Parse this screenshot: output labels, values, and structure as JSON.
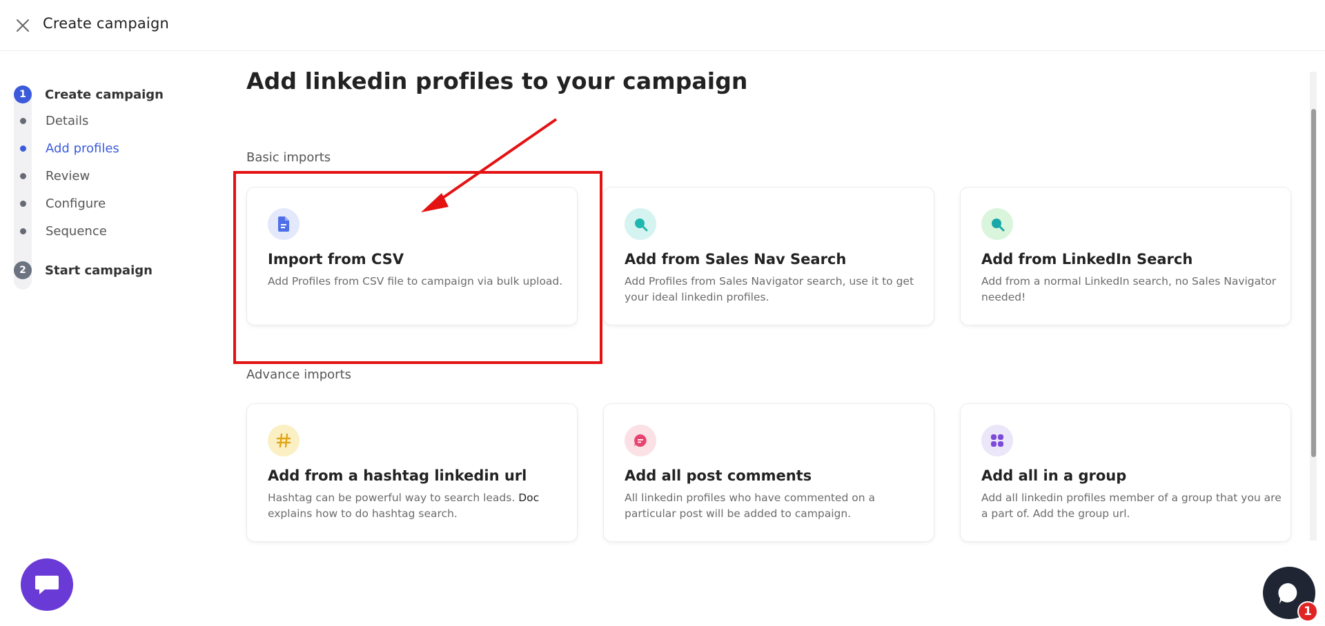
{
  "header": {
    "title": "Create campaign"
  },
  "stepper": {
    "steps": [
      {
        "number": "1",
        "label": "Create campaign"
      },
      {
        "number": "2",
        "label": "Start campaign"
      }
    ],
    "substeps": [
      {
        "label": "Details"
      },
      {
        "label": "Add profiles"
      },
      {
        "label": "Review"
      },
      {
        "label": "Configure"
      },
      {
        "label": "Sequence"
      }
    ]
  },
  "main": {
    "title": "Add linkedin profiles to your campaign",
    "basic_label": "Basic imports",
    "advance_label": "Advance imports",
    "basic_cards": [
      {
        "icon": "document-icon",
        "title": "Import from CSV",
        "desc": "Add Profiles from CSV file to campaign via bulk upload."
      },
      {
        "icon": "search-icon",
        "title": "Add from Sales Nav Search",
        "desc": "Add Profiles from Sales Navigator search, use it to get your ideal linkedin profiles."
      },
      {
        "icon": "search-icon",
        "title": "Add from LinkedIn Search",
        "desc": "Add from a normal LinkedIn search, no Sales Navigator needed!"
      }
    ],
    "advance_cards": [
      {
        "icon": "hashtag-icon",
        "title": "Add from a hashtag linkedin url",
        "desc_before": "Hashtag can be powerful way to search leads.",
        "desc_link": "Doc",
        "desc_after": "explains how to do hashtag search."
      },
      {
        "icon": "comment-icon",
        "title": "Add all post comments",
        "desc": "All linkedin profiles who have commented on a particular post will be added to campaign."
      },
      {
        "icon": "group-icon",
        "title": "Add all in a group",
        "desc": "Add all linkedin profiles member of a group that you are a part of. Add the group url."
      }
    ]
  },
  "chat_badge": "1",
  "colors": {
    "accent": "#3b5bdb",
    "annotation": "#e41212",
    "chat_left": "#6a3ad6",
    "chat_right": "#1f2533"
  }
}
